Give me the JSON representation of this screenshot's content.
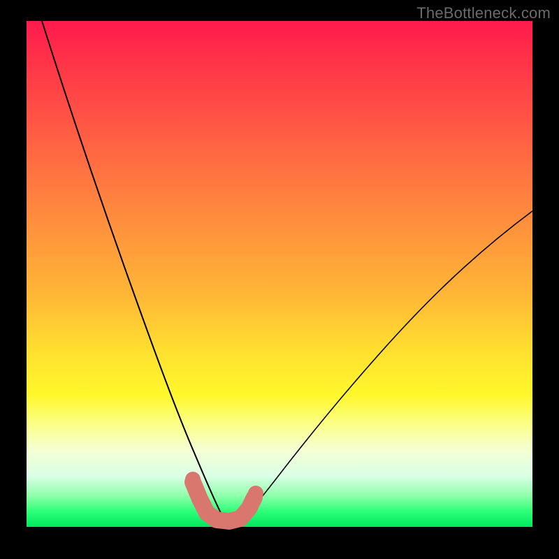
{
  "watermark": "TheBottleneck.com",
  "chart_data": {
    "type": "line",
    "title": "",
    "xlabel": "",
    "ylabel": "",
    "xlim": [
      0,
      100
    ],
    "ylim": [
      0,
      100
    ],
    "gradient_stops": [
      {
        "pos": 0,
        "color": "#ff1a4d"
      },
      {
        "pos": 22,
        "color": "#ff5c44"
      },
      {
        "pos": 54,
        "color": "#ffb636"
      },
      {
        "pos": 74,
        "color": "#fff82c"
      },
      {
        "pos": 90,
        "color": "#d9ffe5"
      },
      {
        "pos": 100,
        "color": "#00e85e"
      }
    ],
    "series": [
      {
        "name": "left-branch",
        "x": [
          3,
          8,
          13,
          18,
          22,
          26,
          29,
          31.5,
          33.5,
          35,
          36.5,
          38
        ],
        "y": [
          100,
          85,
          70,
          56,
          43,
          31,
          21,
          13,
          7,
          3,
          1,
          0
        ]
      },
      {
        "name": "right-branch",
        "x": [
          41,
          44,
          48,
          53,
          59,
          66,
          74,
          82,
          90,
          100
        ],
        "y": [
          0,
          3,
          8,
          15,
          23,
          32,
          41,
          49,
          56,
          63
        ]
      }
    ],
    "marker_cluster": {
      "color": "#d9766d",
      "points": [
        {
          "x": 33,
          "y": 7
        },
        {
          "x": 34,
          "y": 4
        },
        {
          "x": 35,
          "y": 1.5
        },
        {
          "x": 37,
          "y": 0.5
        },
        {
          "x": 39,
          "y": 0.5
        },
        {
          "x": 41,
          "y": 1
        },
        {
          "x": 42.5,
          "y": 3
        },
        {
          "x": 44,
          "y": 5
        }
      ]
    }
  }
}
